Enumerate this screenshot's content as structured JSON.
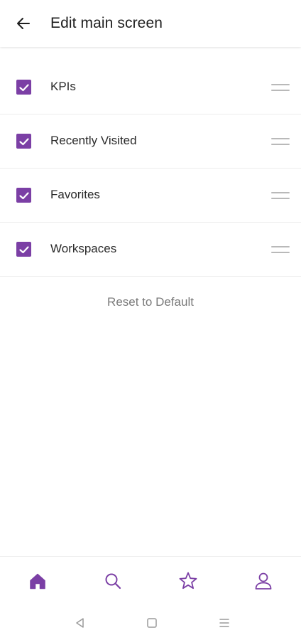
{
  "header": {
    "title": "Edit main screen",
    "back_icon": "arrow-left-icon"
  },
  "colors": {
    "accent": "#7b3fa5",
    "handle": "#b9b9b9",
    "muted_text": "#7a7a7a",
    "divider": "#ececec"
  },
  "sections": [
    {
      "label": "KPIs",
      "checked": true
    },
    {
      "label": "Recently Visited",
      "checked": true
    },
    {
      "label": "Favorites",
      "checked": true
    },
    {
      "label": "Workspaces",
      "checked": true
    }
  ],
  "reset": {
    "label": "Reset to Default"
  },
  "bottom_nav": {
    "items": [
      {
        "icon": "home-icon",
        "active": true
      },
      {
        "icon": "search-icon",
        "active": false
      },
      {
        "icon": "star-icon",
        "active": false
      },
      {
        "icon": "profile-icon",
        "active": false
      }
    ]
  },
  "system_nav": {
    "items": [
      "back-triangle-icon",
      "home-square-icon",
      "recents-menu-icon"
    ]
  }
}
